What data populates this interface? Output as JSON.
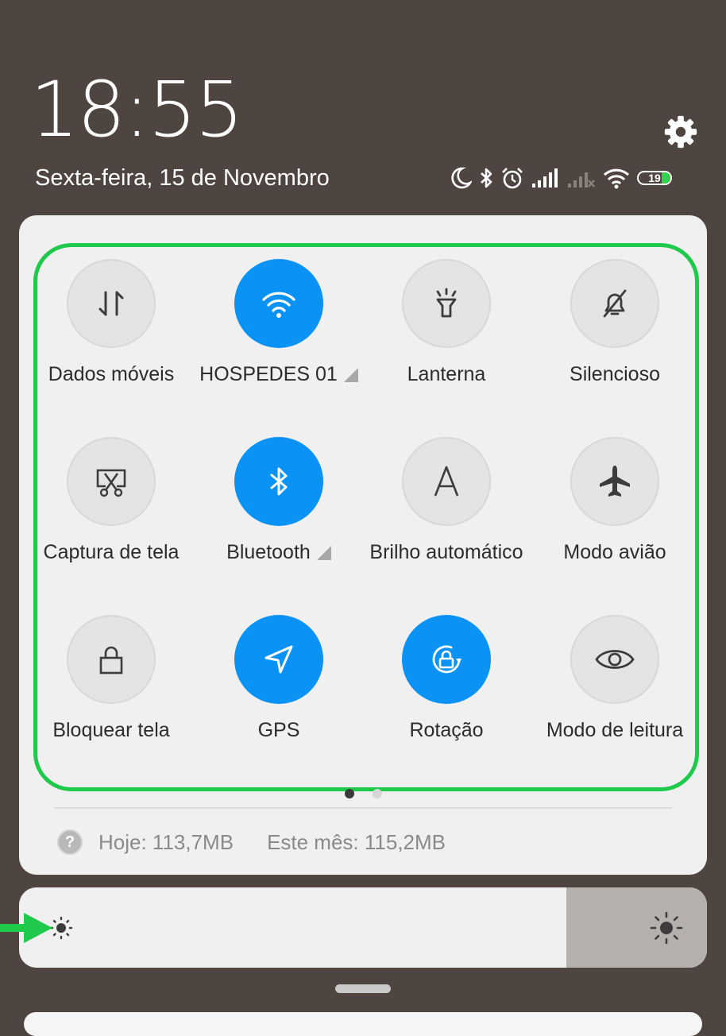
{
  "header": {
    "time": "18:55",
    "date": "Sexta-feira, 15 de Novembro",
    "settings_icon": "gear-icon",
    "status_icons": [
      "moon-icon",
      "bluetooth-icon",
      "alarm-icon",
      "signal-icon",
      "signal-no-service-icon",
      "wifi-icon"
    ],
    "battery_level": "19"
  },
  "tiles": [
    {
      "label": "Dados móveis",
      "icon": "mobile-data-icon",
      "active": false
    },
    {
      "label": "HOSPEDES 01",
      "icon": "wifi-icon",
      "active": true,
      "has_submenu": true
    },
    {
      "label": "Lanterna",
      "icon": "flashlight-icon",
      "active": false
    },
    {
      "label": "Silencioso",
      "icon": "bell-off-icon",
      "active": false
    },
    {
      "label": "Captura de tela",
      "icon": "screenshot-icon",
      "active": false
    },
    {
      "label": "Bluetooth",
      "icon": "bluetooth-icon",
      "active": true,
      "has_submenu": true
    },
    {
      "label": "Brilho automático",
      "icon": "auto-brightness-icon",
      "active": false
    },
    {
      "label": "Modo avião",
      "icon": "airplane-icon",
      "active": false
    },
    {
      "label": "Bloquear tela",
      "icon": "lock-icon",
      "active": false
    },
    {
      "label": "GPS",
      "icon": "location-arrow-icon",
      "active": true
    },
    {
      "label": "Rotação",
      "icon": "rotation-lock-icon",
      "active": true
    },
    {
      "label": "Modo de leitura",
      "icon": "eye-icon",
      "active": false
    }
  ],
  "pager": {
    "pages": 2,
    "current": 1
  },
  "data_usage": {
    "today": "Hoje: 113,7MB",
    "month": "Este mês: 115,2MB"
  },
  "brightness": {
    "level": 0.8
  },
  "colors": {
    "accent": "#0a93f5",
    "highlight": "#1fc94c",
    "panel": "#f0f0f0",
    "background": "#4f4540"
  }
}
